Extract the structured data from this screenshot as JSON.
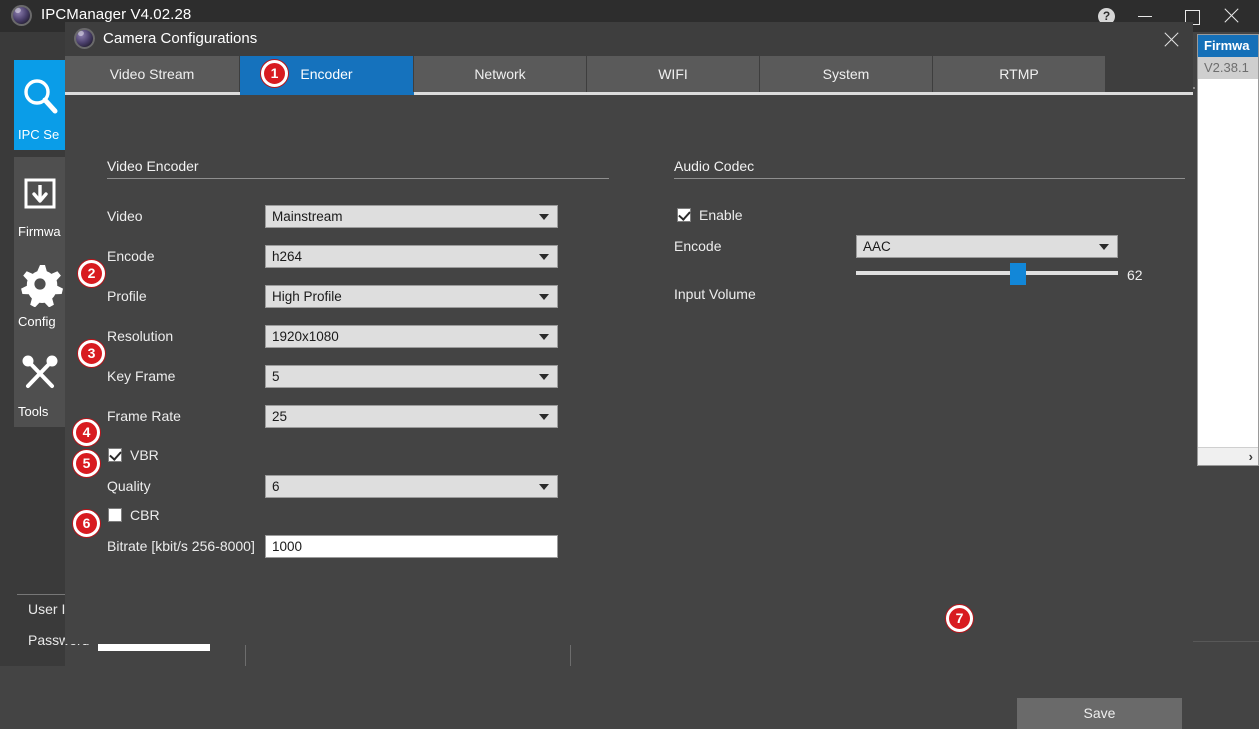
{
  "app": {
    "title": "IPCManager V4.02.28",
    "title_icon": "camera-lens-icon",
    "window_buttons": {
      "help": "?",
      "minimize": "minimize-icon",
      "maximize": "maximize-icon",
      "close": "close-icon"
    }
  },
  "sidebar": {
    "items": [
      {
        "label": "IPC Se",
        "icon": "magnifier-icon",
        "active": true
      },
      {
        "label": "Firmwa",
        "icon": "download-box-icon",
        "active": false
      },
      {
        "label": "Config",
        "icon": "gear-icon",
        "active": false
      },
      {
        "label": "Tools",
        "icon": "wrench-screwdriver-icon",
        "active": false
      }
    ],
    "user_label": "User I",
    "password_label": "Password"
  },
  "background_list": {
    "header": "Firmwa",
    "row": "V2.38.1",
    "scroll_arrow": "›"
  },
  "dialog": {
    "title": "Camera Configurations",
    "icon": "camera-lens-icon",
    "close_icon": "close-icon",
    "tabs": [
      {
        "label": "Video Stream",
        "active": false
      },
      {
        "label": "Encoder",
        "active": true
      },
      {
        "label": "Network",
        "active": false
      },
      {
        "label": "WIFI",
        "active": false
      },
      {
        "label": "System",
        "active": false
      },
      {
        "label": "RTMP",
        "active": false
      }
    ]
  },
  "video_encoder": {
    "section_title": "Video Encoder",
    "fields": {
      "video_label": "Video",
      "video_value": "Mainstream",
      "encode_label": "Encode",
      "encode_value": "h264",
      "profile_label": "Profile",
      "profile_value": "High Profile",
      "resolution_label": "Resolution",
      "resolution_value": "1920x1080",
      "key_frame_label": "Key Frame",
      "key_frame_value": "5",
      "frame_rate_label": "Frame Rate",
      "frame_rate_value": "25",
      "vbr_label": "VBR",
      "vbr_checked": true,
      "quality_label": "Quality",
      "quality_value": "6",
      "cbr_label": "CBR",
      "cbr_checked": false,
      "bitrate_label": "Bitrate [kbit/s 256-8000]",
      "bitrate_value": "1000"
    }
  },
  "audio_codec": {
    "section_title": "Audio Codec",
    "enable_label": "Enable",
    "enable_checked": true,
    "encode_label": "Encode",
    "encode_value": "AAC",
    "input_volume_label": "Input Volume",
    "input_volume_value": "62"
  },
  "actions": {
    "save_label": "Save"
  },
  "badges": [
    "1",
    "2",
    "3",
    "4",
    "5",
    "6",
    "7"
  ],
  "colors": {
    "accent_blue": "#1572bd",
    "rail_active": "#0a9de8",
    "badge_red": "#d81b20",
    "slider_thumb": "#1287d8",
    "window_bg": "#444444",
    "titlebar_bg": "#2d2d2d"
  }
}
